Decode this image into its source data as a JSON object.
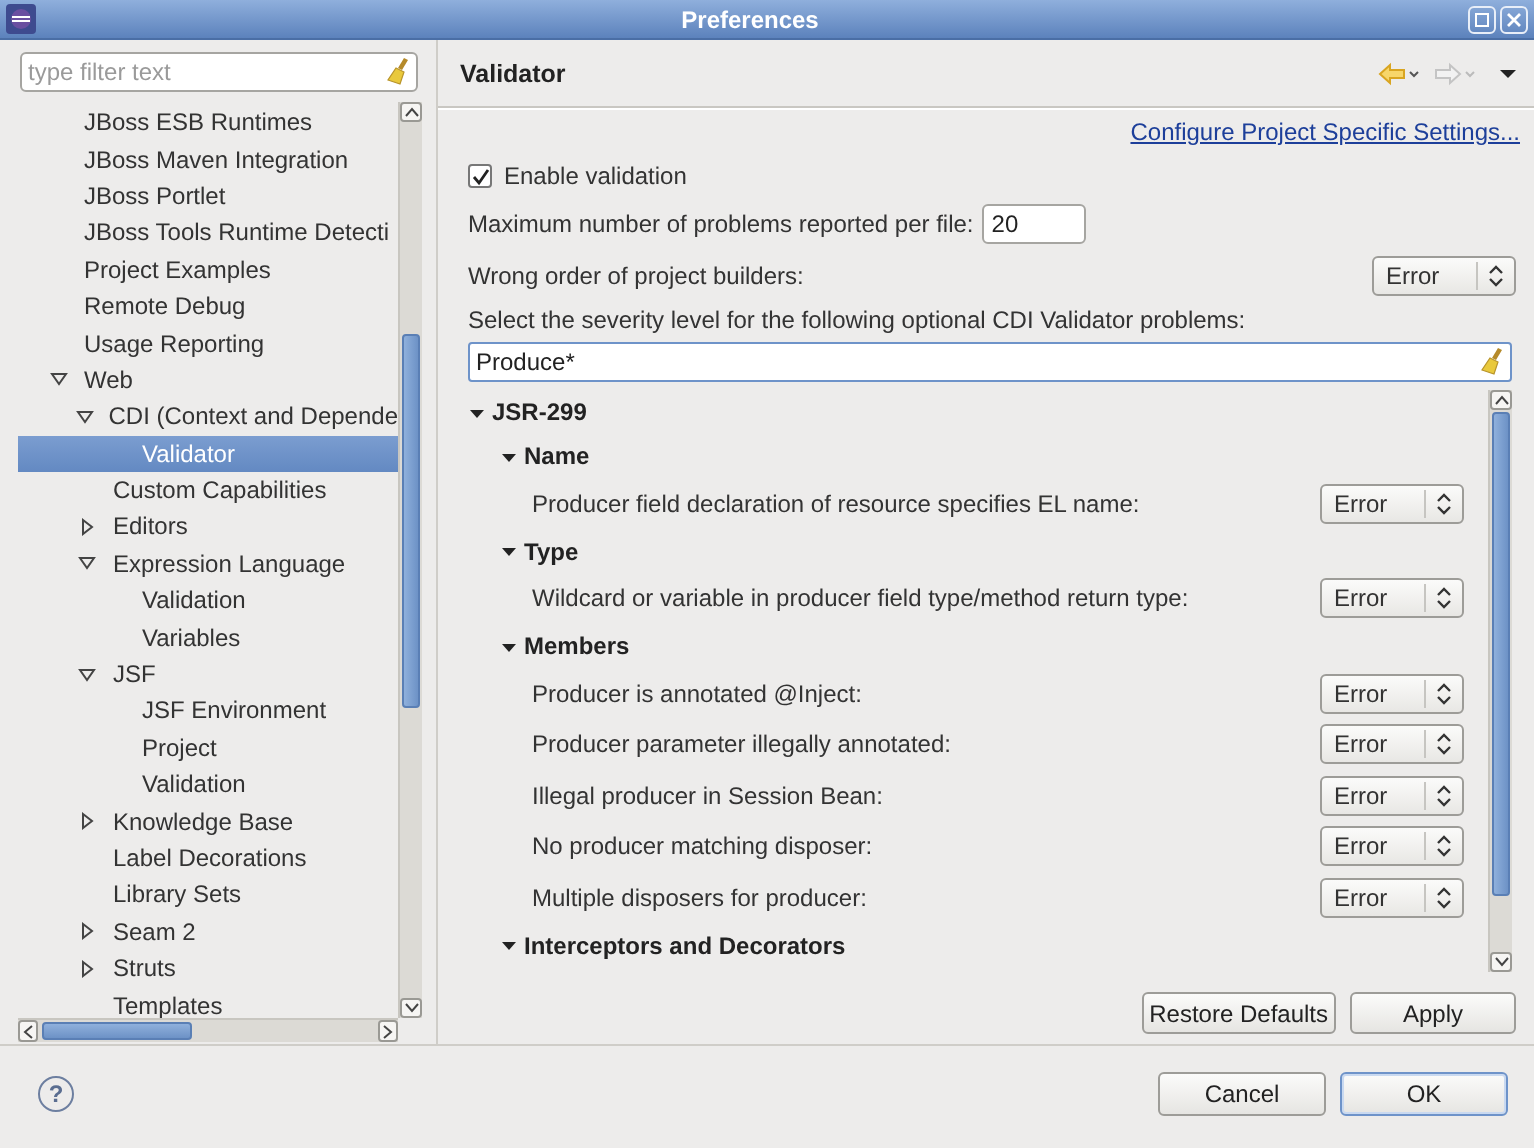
{
  "window": {
    "title": "Preferences"
  },
  "filter": {
    "placeholder": "type filter text"
  },
  "nav_tree": [
    {
      "label": "JBoss ESB Runtimes",
      "selected": false
    },
    {
      "label": "JBoss Maven Integration",
      "selected": false
    },
    {
      "label": "JBoss Portlet",
      "selected": false
    },
    {
      "label": "JBoss Tools Runtime Detecti",
      "selected": false
    },
    {
      "label": "Project Examples",
      "selected": false
    },
    {
      "label": "Remote Debug",
      "selected": false
    },
    {
      "label": "Usage Reporting",
      "selected": false
    },
    {
      "label": "Web",
      "selected": false,
      "expanded": true,
      "children": [
        {
          "label": "CDI (Context and Depende",
          "selected": false,
          "expanded": true,
          "children": [
            {
              "label": "Validator",
              "selected": true
            }
          ]
        },
        {
          "label": "Custom Capabilities",
          "selected": false
        },
        {
          "label": "Editors",
          "selected": false,
          "expanded": false
        },
        {
          "label": "Expression Language",
          "selected": false,
          "expanded": true,
          "children": [
            {
              "label": "Validation",
              "selected": false
            },
            {
              "label": "Variables",
              "selected": false
            }
          ]
        },
        {
          "label": "JSF",
          "selected": false,
          "expanded": true,
          "children": [
            {
              "label": "JSF Environment",
              "selected": false
            },
            {
              "label": "Project",
              "selected": false
            },
            {
              "label": "Validation",
              "selected": false
            }
          ]
        },
        {
          "label": "Knowledge Base",
          "selected": false,
          "expanded": false
        },
        {
          "label": "Label Decorations",
          "selected": false
        },
        {
          "label": "Library Sets",
          "selected": false
        },
        {
          "label": "Seam 2",
          "selected": false,
          "expanded": false
        },
        {
          "label": "Struts",
          "selected": false,
          "expanded": false
        },
        {
          "label": "Templates",
          "selected": false
        }
      ]
    }
  ],
  "page": {
    "title": "Validator",
    "history_buttons": [
      {
        "kind": "back",
        "disabled": false
      },
      {
        "kind": "forward",
        "disabled": true
      }
    ],
    "link": "Configure Project Specific Settings...",
    "enable_validation": {
      "label": "Enable validation",
      "checked": true
    },
    "max_problems": {
      "label": "Maximum number of problems reported per file:",
      "value": "20"
    },
    "builder_order": {
      "label": "Wrong order of project builders:",
      "severity": "Error"
    },
    "severity_intro": "Select the severity level for the following optional CDI Validator problems:",
    "problem_filter": {
      "value": "Produce*"
    },
    "problems": [
      {
        "label": "JSR-299",
        "expanded": true,
        "children": [
          {
            "label": "Name",
            "expanded": true,
            "children": [
              {
                "label": "Producer field declaration of resource specifies EL name:",
                "severity": "Error"
              }
            ]
          },
          {
            "label": "Type",
            "expanded": true,
            "children": [
              {
                "label": "Wildcard or variable in producer field type/method return type:",
                "severity": "Error"
              }
            ]
          },
          {
            "label": "Members",
            "expanded": true,
            "children": [
              {
                "label": "Producer is annotated @Inject:",
                "severity": "Error"
              },
              {
                "label": "Producer parameter illegally annotated:",
                "severity": "Error"
              },
              {
                "label": "Illegal producer in Session Bean:",
                "severity": "Error"
              },
              {
                "label": "No producer matching disposer:",
                "severity": "Error"
              },
              {
                "label": "Multiple disposers for producer:",
                "severity": "Error"
              }
            ]
          },
          {
            "label": "Interceptors and Decorators",
            "expanded": true
          }
        ]
      }
    ],
    "buttons": [
      "Restore Defaults",
      "Apply"
    ]
  },
  "help": "?",
  "dialog_buttons": [
    {
      "label": "Cancel",
      "default": false
    },
    {
      "label": "OK",
      "default": true
    }
  ]
}
